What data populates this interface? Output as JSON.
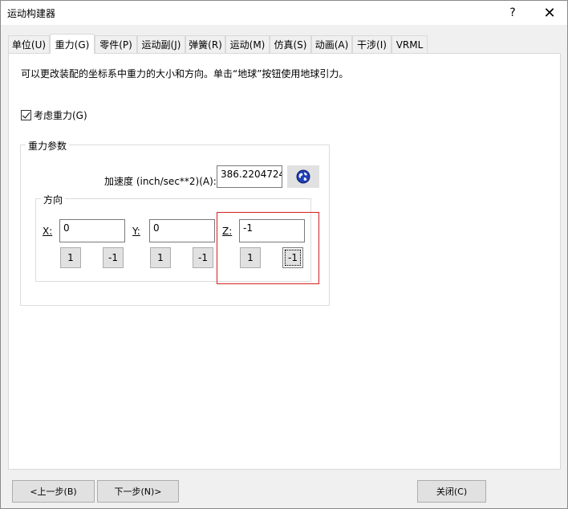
{
  "window": {
    "title": "运动构建器",
    "help": "?",
    "close": "✕"
  },
  "tabs": [
    {
      "label": "单位(U)"
    },
    {
      "label": "重力(G)"
    },
    {
      "label": "零件(P)"
    },
    {
      "label": "运动副(J)"
    },
    {
      "label": "弹簧(R)"
    },
    {
      "label": "运动(M)"
    },
    {
      "label": "仿真(S)"
    },
    {
      "label": "动画(A)"
    },
    {
      "label": "干涉(I)"
    },
    {
      "label": "VRML"
    }
  ],
  "active_tab": "重力(G)",
  "description": "可以更改装配的坐标系中重力的大小和方向。单击“地球”按钮使用地球引力。",
  "consider_gravity": {
    "label": "考虑重力(G)",
    "checked": true
  },
  "gravity_params": {
    "group_label": "重力参数",
    "accel_label": "加速度 (inch/sec**2)(A):",
    "accel_value": "386.2204724",
    "earth_icon": "globe-icon"
  },
  "direction": {
    "group_label": "方向",
    "x": {
      "label": "X:",
      "value": "0",
      "plus": "1",
      "minus": "-1"
    },
    "y": {
      "label": "Y:",
      "value": "0",
      "plus": "1",
      "minus": "-1"
    },
    "z": {
      "label": "Z:",
      "value": "-1",
      "plus": "1",
      "minus": "-1"
    }
  },
  "footer": {
    "prev": "<上一步(B)",
    "next": "下一步(N)>",
    "close": "关闭(C)"
  },
  "colors": {
    "highlight": "#d61f1f",
    "panel_bg": "#ffffff",
    "window_bg": "#f0f0f0"
  }
}
